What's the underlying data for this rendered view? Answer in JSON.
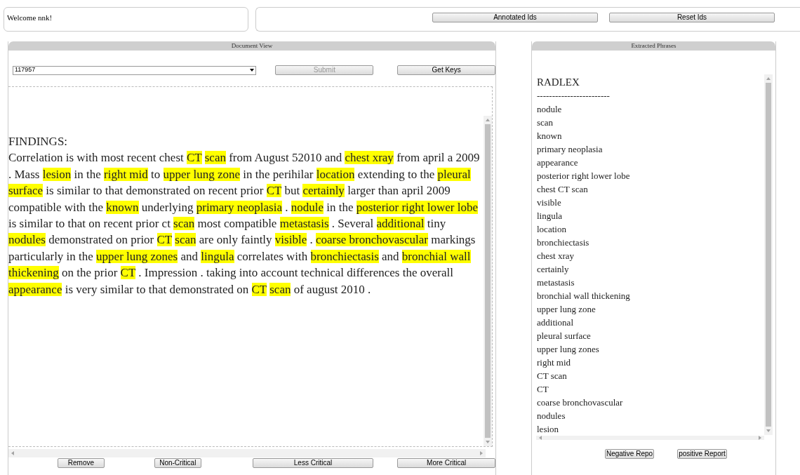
{
  "welcome": "Welcome nnk!",
  "top_buttons": [
    {
      "label": "Annotated Ids"
    },
    {
      "label": "Reset Ids"
    }
  ],
  "document_view": {
    "title": "Document View",
    "select": {
      "value": "117957"
    },
    "actions": [
      {
        "label": "Submit",
        "disabled": true
      },
      {
        "label": "Get Keys",
        "disabled": false
      }
    ],
    "heading": "FINDINGS:",
    "segments": [
      {
        "text": "Correlation is with most recent chest ",
        "highlighted": false
      },
      {
        "text": "CT",
        "highlighted": true
      },
      {
        "text": "scan",
        "highlighted": true,
        "gap_before": true
      },
      {
        "text": " from August 52010 and ",
        "highlighted": false
      },
      {
        "text": "chest xray",
        "highlighted": true
      },
      {
        "text": " from april a 2009 . Mass ",
        "highlighted": false
      },
      {
        "text": "lesion",
        "highlighted": true
      },
      {
        "text": " in the ",
        "highlighted": false
      },
      {
        "text": "right mid",
        "highlighted": true
      },
      {
        "text": " to ",
        "highlighted": false
      },
      {
        "text": "upper lung zone",
        "highlighted": true
      },
      {
        "text": " in the perihilar ",
        "highlighted": false
      },
      {
        "text": "location",
        "highlighted": true
      },
      {
        "text": " extending to the ",
        "highlighted": false
      },
      {
        "text": "pleural surface",
        "highlighted": true
      },
      {
        "text": " is similar to that demonstrated on recent prior ",
        "highlighted": false
      },
      {
        "text": "CT",
        "highlighted": true
      },
      {
        "text": " but ",
        "highlighted": false
      },
      {
        "text": "certainly",
        "highlighted": true
      },
      {
        "text": " larger than april 2009 compatible with the ",
        "highlighted": false
      },
      {
        "text": "known",
        "highlighted": true
      },
      {
        "text": " underlying ",
        "highlighted": false
      },
      {
        "text": "primary neoplasia",
        "highlighted": true
      },
      {
        "text": " . ",
        "highlighted": false
      },
      {
        "text": "nodule",
        "highlighted": true
      },
      {
        "text": " in the ",
        "highlighted": false
      },
      {
        "text": "posterior right lower lobe",
        "highlighted": true
      },
      {
        "text": " is similar to that on recent prior ct ",
        "highlighted": false
      },
      {
        "text": "scan",
        "highlighted": true
      },
      {
        "text": " most compatible ",
        "highlighted": false
      },
      {
        "text": "metastasis",
        "highlighted": true
      },
      {
        "text": " . Several ",
        "highlighted": false
      },
      {
        "text": "additional",
        "highlighted": true
      },
      {
        "text": " tiny ",
        "highlighted": false
      },
      {
        "text": "nodules",
        "highlighted": true
      },
      {
        "text": " demonstrated on prior ",
        "highlighted": false
      },
      {
        "text": "CT",
        "highlighted": true
      },
      {
        "text": "scan",
        "highlighted": true,
        "gap_before": true
      },
      {
        "text": " are only faintly ",
        "highlighted": false
      },
      {
        "text": "visible",
        "highlighted": true
      },
      {
        "text": " . ",
        "highlighted": false
      },
      {
        "text": "coarse bronchovascular",
        "highlighted": true
      },
      {
        "text": " markings particularly in the ",
        "highlighted": false
      },
      {
        "text": "upper lung zones",
        "highlighted": true
      },
      {
        "text": " and ",
        "highlighted": false
      },
      {
        "text": "lingula",
        "highlighted": true
      },
      {
        "text": " correlates with ",
        "highlighted": false
      },
      {
        "text": "bronchiectasis",
        "highlighted": true
      },
      {
        "text": " and ",
        "highlighted": false
      },
      {
        "text": "bronchial wall thickening",
        "highlighted": true
      },
      {
        "text": " on the prior ",
        "highlighted": false
      },
      {
        "text": "CT",
        "highlighted": true
      },
      {
        "text": " . Impression . taking into account technical differences the overall ",
        "highlighted": false
      },
      {
        "text": "appearance",
        "highlighted": true
      },
      {
        "text": " is very similar to that demonstrated on ",
        "highlighted": false
      },
      {
        "text": "CT",
        "highlighted": true
      },
      {
        "text": "scan",
        "highlighted": true,
        "gap_before": true
      },
      {
        "text": " of august 2010 .",
        "highlighted": false
      }
    ],
    "buttons": [
      {
        "label": "Remove"
      },
      {
        "label": "Non-Critical"
      },
      {
        "label": "Less Critical"
      },
      {
        "label": "More Critical"
      }
    ]
  },
  "extracted_phrases": {
    "title": "Extracted Phrases",
    "heading": "RADLEX",
    "separator": "------------------------",
    "items": [
      "nodule",
      "scan",
      "known",
      "primary neoplasia",
      "appearance",
      "posterior right lower lobe",
      "chest CT scan",
      "visible",
      "lingula",
      "location",
      "bronchiectasis",
      "chest xray",
      "certainly",
      "metastasis",
      "bronchial wall thickening",
      "upper lung zone",
      "additional",
      "pleural surface",
      "upper lung zones",
      "right mid",
      "CT scan",
      "CT",
      "coarse bronchovascular",
      "nodules",
      "lesion"
    ],
    "buttons": [
      {
        "label": "Negative Repo"
      },
      {
        "label": "positive Report"
      }
    ]
  }
}
